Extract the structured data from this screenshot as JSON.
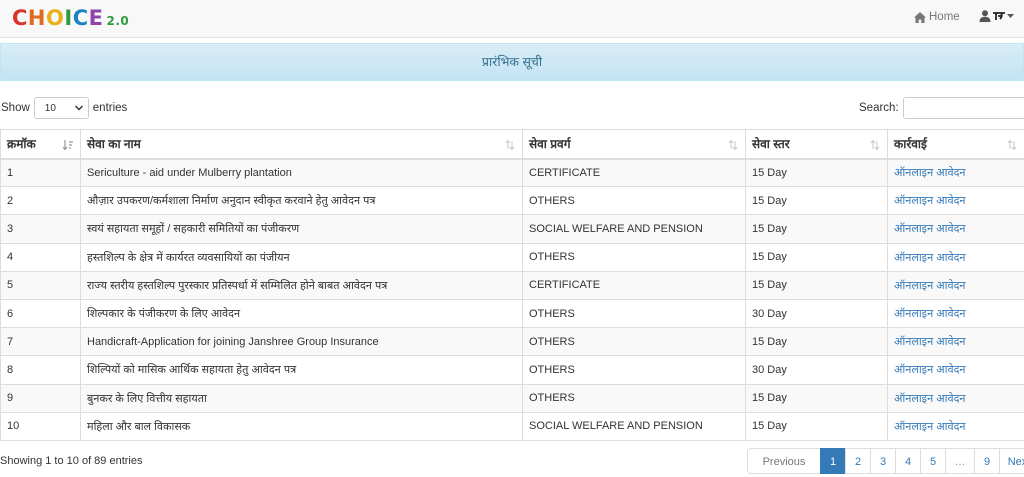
{
  "brand": {
    "logo_letters": [
      "C",
      "H",
      "O",
      "I",
      "C",
      "E"
    ],
    "version": "2.0"
  },
  "nav": {
    "home_label": "Home"
  },
  "banner": {
    "title": "प्रारंभिक सूची"
  },
  "length_menu": {
    "show_label": "Show",
    "selected": "10",
    "entries_label": "entries"
  },
  "search": {
    "label": "Search:",
    "value": ""
  },
  "table": {
    "headers": [
      "क्रमॉक",
      "सेवा का नाम",
      "सेवा प्रवर्ग",
      "सेवा स्तर",
      "कार्रवाई"
    ],
    "rows": [
      {
        "no": "1",
        "name": "Sericulture - aid under Mulberry plantation",
        "category": "CERTIFICATE",
        "level": "15 Day",
        "action": "ऑनलाइन आवेदन"
      },
      {
        "no": "2",
        "name": "औज़ार उपकरण/कर्मशाला निर्माण अनुदान स्वीकृत करवाने हेतु आवेदन पत्र",
        "category": "OTHERS",
        "level": "15 Day",
        "action": "ऑनलाइन आवेदन"
      },
      {
        "no": "3",
        "name": "स्वयं सहायता समूहों / सहकारी समितियों का पंजीकरण",
        "category": "SOCIAL WELFARE AND PENSION",
        "level": "15 Day",
        "action": "ऑनलाइन आवेदन"
      },
      {
        "no": "4",
        "name": "हस्तशिल्प के क्षेत्र में कार्यरत व्यवसायियों का पंजीयन",
        "category": "OTHERS",
        "level": "15 Day",
        "action": "ऑनलाइन आवेदन"
      },
      {
        "no": "5",
        "name": "राज्य स्तरीय हस्तशिल्प पुरस्कार प्रतिस्पर्धा में सम्मिलित होने बाबत आवेदन पत्र",
        "category": "CERTIFICATE",
        "level": "15 Day",
        "action": "ऑनलाइन आवेदन"
      },
      {
        "no": "6",
        "name": "शिल्पकार के पंजीकरण के लिए आवेदन",
        "category": "OTHERS",
        "level": "30 Day",
        "action": "ऑनलाइन आवेदन"
      },
      {
        "no": "7",
        "name": "Handicraft-Application for joining Janshree Group Insurance",
        "category": "OTHERS",
        "level": "15 Day",
        "action": "ऑनलाइन आवेदन"
      },
      {
        "no": "8",
        "name": "शिल्पियों को मासिक आर्थिक सहायता हेतु आवेदन पत्र",
        "category": "OTHERS",
        "level": "30 Day",
        "action": "ऑनलाइन आवेदन"
      },
      {
        "no": "9",
        "name": "बुनकर के लिए वित्तीय सहायता",
        "category": "OTHERS",
        "level": "15 Day",
        "action": "ऑनलाइन आवेदन"
      },
      {
        "no": "10",
        "name": "महिला और बाल विकासक",
        "category": "SOCIAL WELFARE AND PENSION",
        "level": "15 Day",
        "action": "ऑनलाइन आवेदन"
      }
    ]
  },
  "footer": {
    "info": "Showing 1 to 10 of 89 entries",
    "pagination": {
      "previous": "Previous",
      "pages": [
        "1",
        "2",
        "3",
        "4",
        "5"
      ],
      "ellipsis": "…",
      "last": "9",
      "next": "Next",
      "active": "1"
    }
  },
  "colors": {
    "link": "#337ab7",
    "banner_text": "#31708f",
    "active_page": "#337ab7"
  },
  "icons": {
    "home": "home-icon",
    "user": "user-icon",
    "caret": "caret-down-icon",
    "sort_asc": "sort-asc-icon",
    "sort_both": "sort-both-icon"
  }
}
